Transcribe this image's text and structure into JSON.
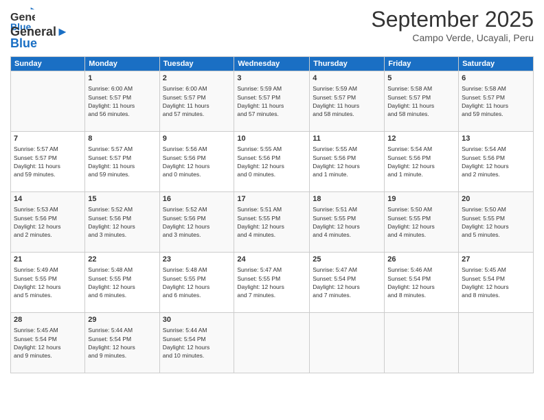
{
  "header": {
    "logo_general": "General",
    "logo_blue": "Blue",
    "month_title": "September 2025",
    "subtitle": "Campo Verde, Ucayali, Peru"
  },
  "weekdays": [
    "Sunday",
    "Monday",
    "Tuesday",
    "Wednesday",
    "Thursday",
    "Friday",
    "Saturday"
  ],
  "weeks": [
    [
      {
        "day": "",
        "info": ""
      },
      {
        "day": "1",
        "info": "Sunrise: 6:00 AM\nSunset: 5:57 PM\nDaylight: 11 hours\nand 56 minutes."
      },
      {
        "day": "2",
        "info": "Sunrise: 6:00 AM\nSunset: 5:57 PM\nDaylight: 11 hours\nand 57 minutes."
      },
      {
        "day": "3",
        "info": "Sunrise: 5:59 AM\nSunset: 5:57 PM\nDaylight: 11 hours\nand 57 minutes."
      },
      {
        "day": "4",
        "info": "Sunrise: 5:59 AM\nSunset: 5:57 PM\nDaylight: 11 hours\nand 58 minutes."
      },
      {
        "day": "5",
        "info": "Sunrise: 5:58 AM\nSunset: 5:57 PM\nDaylight: 11 hours\nand 58 minutes."
      },
      {
        "day": "6",
        "info": "Sunrise: 5:58 AM\nSunset: 5:57 PM\nDaylight: 11 hours\nand 59 minutes."
      }
    ],
    [
      {
        "day": "7",
        "info": "Sunrise: 5:57 AM\nSunset: 5:57 PM\nDaylight: 11 hours\nand 59 minutes."
      },
      {
        "day": "8",
        "info": "Sunrise: 5:57 AM\nSunset: 5:57 PM\nDaylight: 11 hours\nand 59 minutes."
      },
      {
        "day": "9",
        "info": "Sunrise: 5:56 AM\nSunset: 5:56 PM\nDaylight: 12 hours\nand 0 minutes."
      },
      {
        "day": "10",
        "info": "Sunrise: 5:55 AM\nSunset: 5:56 PM\nDaylight: 12 hours\nand 0 minutes."
      },
      {
        "day": "11",
        "info": "Sunrise: 5:55 AM\nSunset: 5:56 PM\nDaylight: 12 hours\nand 1 minute."
      },
      {
        "day": "12",
        "info": "Sunrise: 5:54 AM\nSunset: 5:56 PM\nDaylight: 12 hours\nand 1 minute."
      },
      {
        "day": "13",
        "info": "Sunrise: 5:54 AM\nSunset: 5:56 PM\nDaylight: 12 hours\nand 2 minutes."
      }
    ],
    [
      {
        "day": "14",
        "info": "Sunrise: 5:53 AM\nSunset: 5:56 PM\nDaylight: 12 hours\nand 2 minutes."
      },
      {
        "day": "15",
        "info": "Sunrise: 5:52 AM\nSunset: 5:56 PM\nDaylight: 12 hours\nand 3 minutes."
      },
      {
        "day": "16",
        "info": "Sunrise: 5:52 AM\nSunset: 5:56 PM\nDaylight: 12 hours\nand 3 minutes."
      },
      {
        "day": "17",
        "info": "Sunrise: 5:51 AM\nSunset: 5:55 PM\nDaylight: 12 hours\nand 4 minutes."
      },
      {
        "day": "18",
        "info": "Sunrise: 5:51 AM\nSunset: 5:55 PM\nDaylight: 12 hours\nand 4 minutes."
      },
      {
        "day": "19",
        "info": "Sunrise: 5:50 AM\nSunset: 5:55 PM\nDaylight: 12 hours\nand 4 minutes."
      },
      {
        "day": "20",
        "info": "Sunrise: 5:50 AM\nSunset: 5:55 PM\nDaylight: 12 hours\nand 5 minutes."
      }
    ],
    [
      {
        "day": "21",
        "info": "Sunrise: 5:49 AM\nSunset: 5:55 PM\nDaylight: 12 hours\nand 5 minutes."
      },
      {
        "day": "22",
        "info": "Sunrise: 5:48 AM\nSunset: 5:55 PM\nDaylight: 12 hours\nand 6 minutes."
      },
      {
        "day": "23",
        "info": "Sunrise: 5:48 AM\nSunset: 5:55 PM\nDaylight: 12 hours\nand 6 minutes."
      },
      {
        "day": "24",
        "info": "Sunrise: 5:47 AM\nSunset: 5:55 PM\nDaylight: 12 hours\nand 7 minutes."
      },
      {
        "day": "25",
        "info": "Sunrise: 5:47 AM\nSunset: 5:54 PM\nDaylight: 12 hours\nand 7 minutes."
      },
      {
        "day": "26",
        "info": "Sunrise: 5:46 AM\nSunset: 5:54 PM\nDaylight: 12 hours\nand 8 minutes."
      },
      {
        "day": "27",
        "info": "Sunrise: 5:45 AM\nSunset: 5:54 PM\nDaylight: 12 hours\nand 8 minutes."
      }
    ],
    [
      {
        "day": "28",
        "info": "Sunrise: 5:45 AM\nSunset: 5:54 PM\nDaylight: 12 hours\nand 9 minutes."
      },
      {
        "day": "29",
        "info": "Sunrise: 5:44 AM\nSunset: 5:54 PM\nDaylight: 12 hours\nand 9 minutes."
      },
      {
        "day": "30",
        "info": "Sunrise: 5:44 AM\nSunset: 5:54 PM\nDaylight: 12 hours\nand 10 minutes."
      },
      {
        "day": "",
        "info": ""
      },
      {
        "day": "",
        "info": ""
      },
      {
        "day": "",
        "info": ""
      },
      {
        "day": "",
        "info": ""
      }
    ]
  ]
}
